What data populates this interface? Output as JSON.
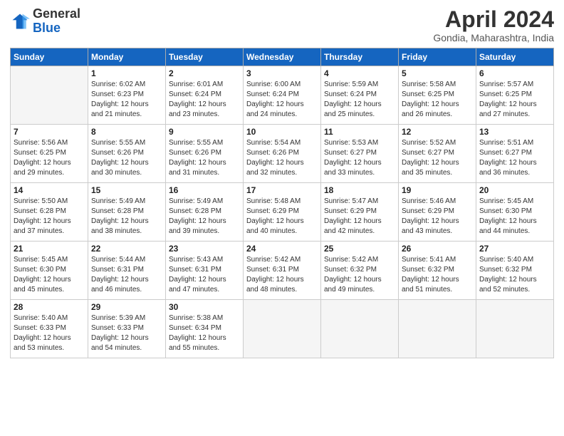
{
  "logo": {
    "general": "General",
    "blue": "Blue"
  },
  "title": "April 2024",
  "location": "Gondia, Maharashtra, India",
  "days_header": [
    "Sunday",
    "Monday",
    "Tuesday",
    "Wednesday",
    "Thursday",
    "Friday",
    "Saturday"
  ],
  "weeks": [
    [
      {
        "day": "",
        "info": ""
      },
      {
        "day": "1",
        "info": "Sunrise: 6:02 AM\nSunset: 6:23 PM\nDaylight: 12 hours\nand 21 minutes."
      },
      {
        "day": "2",
        "info": "Sunrise: 6:01 AM\nSunset: 6:24 PM\nDaylight: 12 hours\nand 23 minutes."
      },
      {
        "day": "3",
        "info": "Sunrise: 6:00 AM\nSunset: 6:24 PM\nDaylight: 12 hours\nand 24 minutes."
      },
      {
        "day": "4",
        "info": "Sunrise: 5:59 AM\nSunset: 6:24 PM\nDaylight: 12 hours\nand 25 minutes."
      },
      {
        "day": "5",
        "info": "Sunrise: 5:58 AM\nSunset: 6:25 PM\nDaylight: 12 hours\nand 26 minutes."
      },
      {
        "day": "6",
        "info": "Sunrise: 5:57 AM\nSunset: 6:25 PM\nDaylight: 12 hours\nand 27 minutes."
      }
    ],
    [
      {
        "day": "7",
        "info": "Sunrise: 5:56 AM\nSunset: 6:25 PM\nDaylight: 12 hours\nand 29 minutes."
      },
      {
        "day": "8",
        "info": "Sunrise: 5:55 AM\nSunset: 6:26 PM\nDaylight: 12 hours\nand 30 minutes."
      },
      {
        "day": "9",
        "info": "Sunrise: 5:55 AM\nSunset: 6:26 PM\nDaylight: 12 hours\nand 31 minutes."
      },
      {
        "day": "10",
        "info": "Sunrise: 5:54 AM\nSunset: 6:26 PM\nDaylight: 12 hours\nand 32 minutes."
      },
      {
        "day": "11",
        "info": "Sunrise: 5:53 AM\nSunset: 6:27 PM\nDaylight: 12 hours\nand 33 minutes."
      },
      {
        "day": "12",
        "info": "Sunrise: 5:52 AM\nSunset: 6:27 PM\nDaylight: 12 hours\nand 35 minutes."
      },
      {
        "day": "13",
        "info": "Sunrise: 5:51 AM\nSunset: 6:27 PM\nDaylight: 12 hours\nand 36 minutes."
      }
    ],
    [
      {
        "day": "14",
        "info": "Sunrise: 5:50 AM\nSunset: 6:28 PM\nDaylight: 12 hours\nand 37 minutes."
      },
      {
        "day": "15",
        "info": "Sunrise: 5:49 AM\nSunset: 6:28 PM\nDaylight: 12 hours\nand 38 minutes."
      },
      {
        "day": "16",
        "info": "Sunrise: 5:49 AM\nSunset: 6:28 PM\nDaylight: 12 hours\nand 39 minutes."
      },
      {
        "day": "17",
        "info": "Sunrise: 5:48 AM\nSunset: 6:29 PM\nDaylight: 12 hours\nand 40 minutes."
      },
      {
        "day": "18",
        "info": "Sunrise: 5:47 AM\nSunset: 6:29 PM\nDaylight: 12 hours\nand 42 minutes."
      },
      {
        "day": "19",
        "info": "Sunrise: 5:46 AM\nSunset: 6:29 PM\nDaylight: 12 hours\nand 43 minutes."
      },
      {
        "day": "20",
        "info": "Sunrise: 5:45 AM\nSunset: 6:30 PM\nDaylight: 12 hours\nand 44 minutes."
      }
    ],
    [
      {
        "day": "21",
        "info": "Sunrise: 5:45 AM\nSunset: 6:30 PM\nDaylight: 12 hours\nand 45 minutes."
      },
      {
        "day": "22",
        "info": "Sunrise: 5:44 AM\nSunset: 6:31 PM\nDaylight: 12 hours\nand 46 minutes."
      },
      {
        "day": "23",
        "info": "Sunrise: 5:43 AM\nSunset: 6:31 PM\nDaylight: 12 hours\nand 47 minutes."
      },
      {
        "day": "24",
        "info": "Sunrise: 5:42 AM\nSunset: 6:31 PM\nDaylight: 12 hours\nand 48 minutes."
      },
      {
        "day": "25",
        "info": "Sunrise: 5:42 AM\nSunset: 6:32 PM\nDaylight: 12 hours\nand 49 minutes."
      },
      {
        "day": "26",
        "info": "Sunrise: 5:41 AM\nSunset: 6:32 PM\nDaylight: 12 hours\nand 51 minutes."
      },
      {
        "day": "27",
        "info": "Sunrise: 5:40 AM\nSunset: 6:32 PM\nDaylight: 12 hours\nand 52 minutes."
      }
    ],
    [
      {
        "day": "28",
        "info": "Sunrise: 5:40 AM\nSunset: 6:33 PM\nDaylight: 12 hours\nand 53 minutes."
      },
      {
        "day": "29",
        "info": "Sunrise: 5:39 AM\nSunset: 6:33 PM\nDaylight: 12 hours\nand 54 minutes."
      },
      {
        "day": "30",
        "info": "Sunrise: 5:38 AM\nSunset: 6:34 PM\nDaylight: 12 hours\nand 55 minutes."
      },
      {
        "day": "",
        "info": ""
      },
      {
        "day": "",
        "info": ""
      },
      {
        "day": "",
        "info": ""
      },
      {
        "day": "",
        "info": ""
      }
    ]
  ]
}
